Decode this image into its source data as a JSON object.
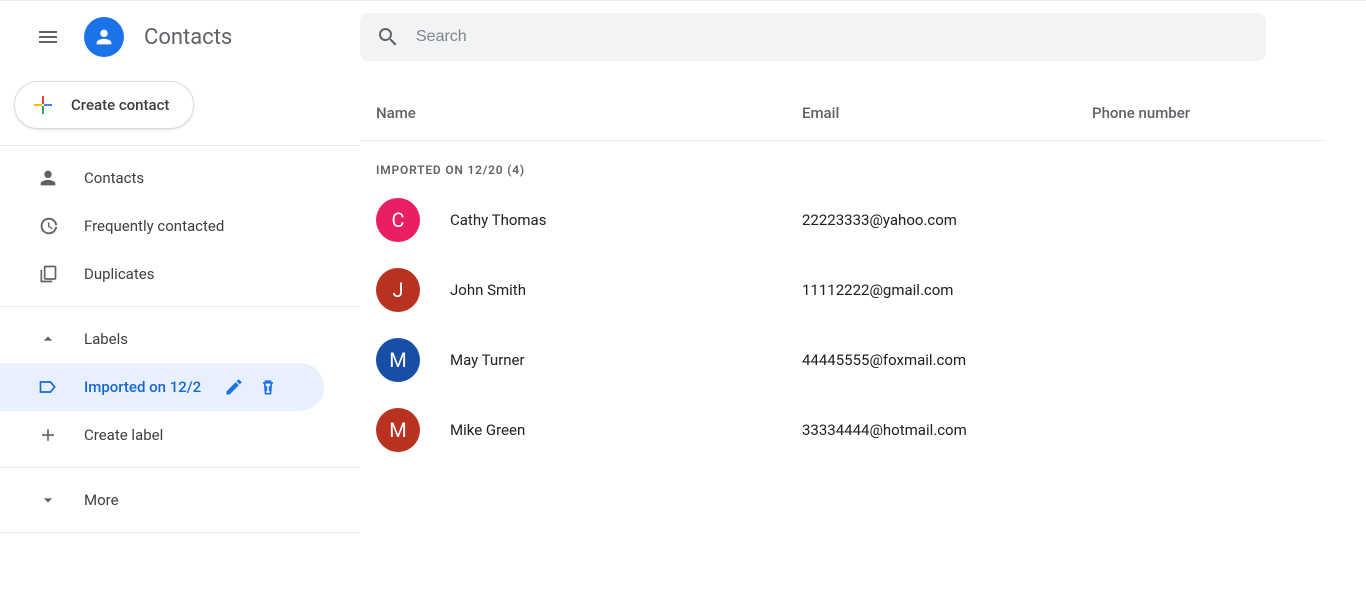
{
  "header": {
    "title": "Contacts"
  },
  "search": {
    "placeholder": "Search"
  },
  "create": {
    "label": "Create contact"
  },
  "sidebar": {
    "items": [
      {
        "label": "Contacts"
      },
      {
        "label": "Frequently contacted"
      },
      {
        "label": "Duplicates"
      }
    ],
    "labels_header": "Labels",
    "active_label": "Imported on 12/2",
    "create_label": "Create label",
    "more": "More"
  },
  "columns": {
    "name": "Name",
    "email": "Email",
    "phone": "Phone number"
  },
  "group": {
    "title": "IMPORTED ON 12/20 (4)"
  },
  "contacts": [
    {
      "initial": "C",
      "name": "Cathy Thomas",
      "email": "22223333@yahoo.com",
      "color": "#e91e63"
    },
    {
      "initial": "J",
      "name": "John Smith",
      "email": "11112222@gmail.com",
      "color": "#b93221"
    },
    {
      "initial": "M",
      "name": "May Turner",
      "email": "44445555@foxmail.com",
      "color": "#174ea6"
    },
    {
      "initial": "M",
      "name": "Mike Green",
      "email": "33334444@hotmail.com",
      "color": "#b93221"
    }
  ]
}
